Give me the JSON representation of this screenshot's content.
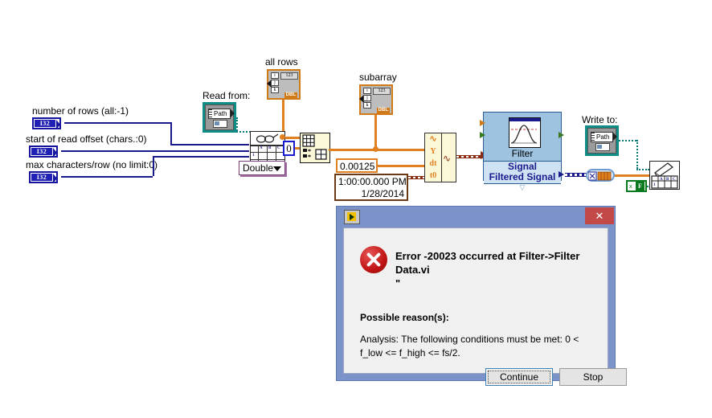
{
  "diagram": {
    "controls": [
      {
        "label": "number of rows (all:-1)",
        "type": "I32"
      },
      {
        "label": "start of read offset (chars.:0)",
        "type": "I32"
      },
      {
        "label": "max characters/row  (no limit:0)",
        "type": "I32"
      }
    ],
    "read_path_label": "Read from:",
    "write_path_label": "Write to:",
    "path_text": "Path",
    "all_rows_label": "all rows",
    "subarray_label": "subarray",
    "index_letters": [
      "i",
      "j",
      "k"
    ],
    "numeric_glyph": "123",
    "dbl_tag": "DBL",
    "format_enum": "Double",
    "index_constant": "0",
    "dt_constant": "0.00125",
    "t0_time": "1:00:00.000 PM",
    "t0_date": "1/28/2014",
    "waveform_ports": [
      "Y",
      "dt",
      "t0"
    ],
    "filter": {
      "name": "Filter",
      "input_terminal": "Signal",
      "output_terminal": "Filtered Signal"
    },
    "false_constant": "F"
  },
  "dialog": {
    "title_icon": "labview-icon",
    "close_label": "✕",
    "error_heading": "Error -20023 occurred at Filter->Filter Data.vi",
    "error_heading_line2": "\"",
    "possible_reasons_label": "Possible reason(s):",
    "analysis_text": "Analysis:  The following conditions must be met:  0 < f_low <= f_high <= fs/2.",
    "buttons": {
      "continue": "Continue",
      "stop": "Stop"
    }
  },
  "colors": {
    "wire_blue": "#1a1a8c",
    "wire_orange": "#e08020",
    "wire_teal": "#0a7c78",
    "dialog_frame": "#7b93c9",
    "close_red": "#c34949",
    "express_vi": "#9dc3e0",
    "error_red": "#c01414"
  }
}
